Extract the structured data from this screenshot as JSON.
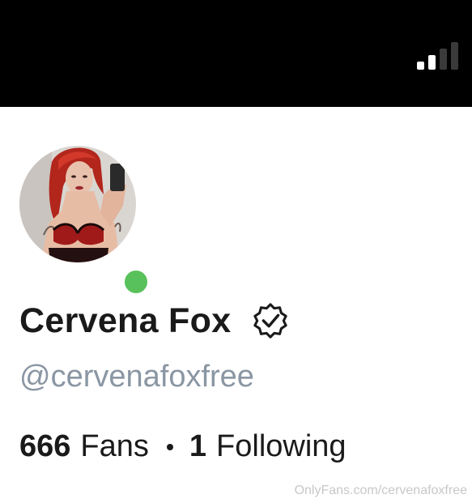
{
  "status_bar": {
    "signal_icon": "cellular-signal-icon",
    "signal_level": 0.5
  },
  "profile": {
    "avatar_icon": "profile-avatar",
    "online_status": "online",
    "name": "Cervena Fox",
    "verified_icon": "verified-badge-icon",
    "handle": "@cervenafoxfree",
    "fans_count": "666",
    "fans_label": "Fans",
    "following_count": "1",
    "following_label": "Following"
  },
  "watermark": "OnlyFans.com/cervenafoxfree",
  "colors": {
    "status_bar_bg": "#000000",
    "online_green": "#58c15b",
    "handle_gray": "#8a96a3",
    "text_dark": "#1a1a1a"
  }
}
